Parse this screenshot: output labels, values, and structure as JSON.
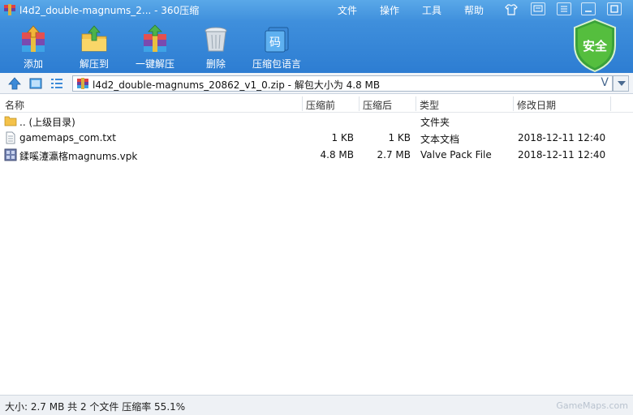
{
  "titlebar": {
    "title": "l4d2_double-magnums_2... - 360压缩",
    "menu": [
      "文件",
      "操作",
      "工具",
      "帮助"
    ]
  },
  "toolbar": {
    "items": [
      {
        "label": "添加",
        "icon": "add-archive-icon"
      },
      {
        "label": "解压到",
        "icon": "extract-to-icon"
      },
      {
        "label": "一键解压",
        "icon": "one-click-extract-icon"
      },
      {
        "label": "删除",
        "icon": "delete-trash-icon"
      },
      {
        "label": "压缩包语言",
        "icon": "archive-language-icon"
      }
    ],
    "language_glyph": "码",
    "security_label": "安全"
  },
  "addressbar": {
    "path": "l4d2_double-magnums_20862_v1_0.zip - 解包大小为 4.8 MB",
    "history_glyph": "V"
  },
  "columns": [
    "名称",
    "压缩前",
    "压缩后",
    "类型",
    "修改日期"
  ],
  "files": [
    {
      "name": ".. (上级目录)",
      "before": "",
      "after": "",
      "type": "文件夹",
      "date": "",
      "icon": "folder-icon"
    },
    {
      "name": "gamemaps_com.txt",
      "before": "1 KB",
      "after": "1 KB",
      "type": "文本文档",
      "date": "2018-12-11 12:40",
      "icon": "text-file-icon"
    },
    {
      "name": "鍒嗘瀽瀛楁magnums.vpk",
      "before": "4.8 MB",
      "after": "2.7 MB",
      "type": "Valve Pack File",
      "date": "2018-12-11 12:40",
      "icon": "vpk-file-icon"
    }
  ],
  "status": {
    "text": "大小: 2.7 MB 共 2 个文件 压缩率 55.1%",
    "watermark": "GameMaps.com"
  },
  "colors": {
    "title_blue": "#3f8fdc",
    "shield_green": "#3aa23a"
  }
}
